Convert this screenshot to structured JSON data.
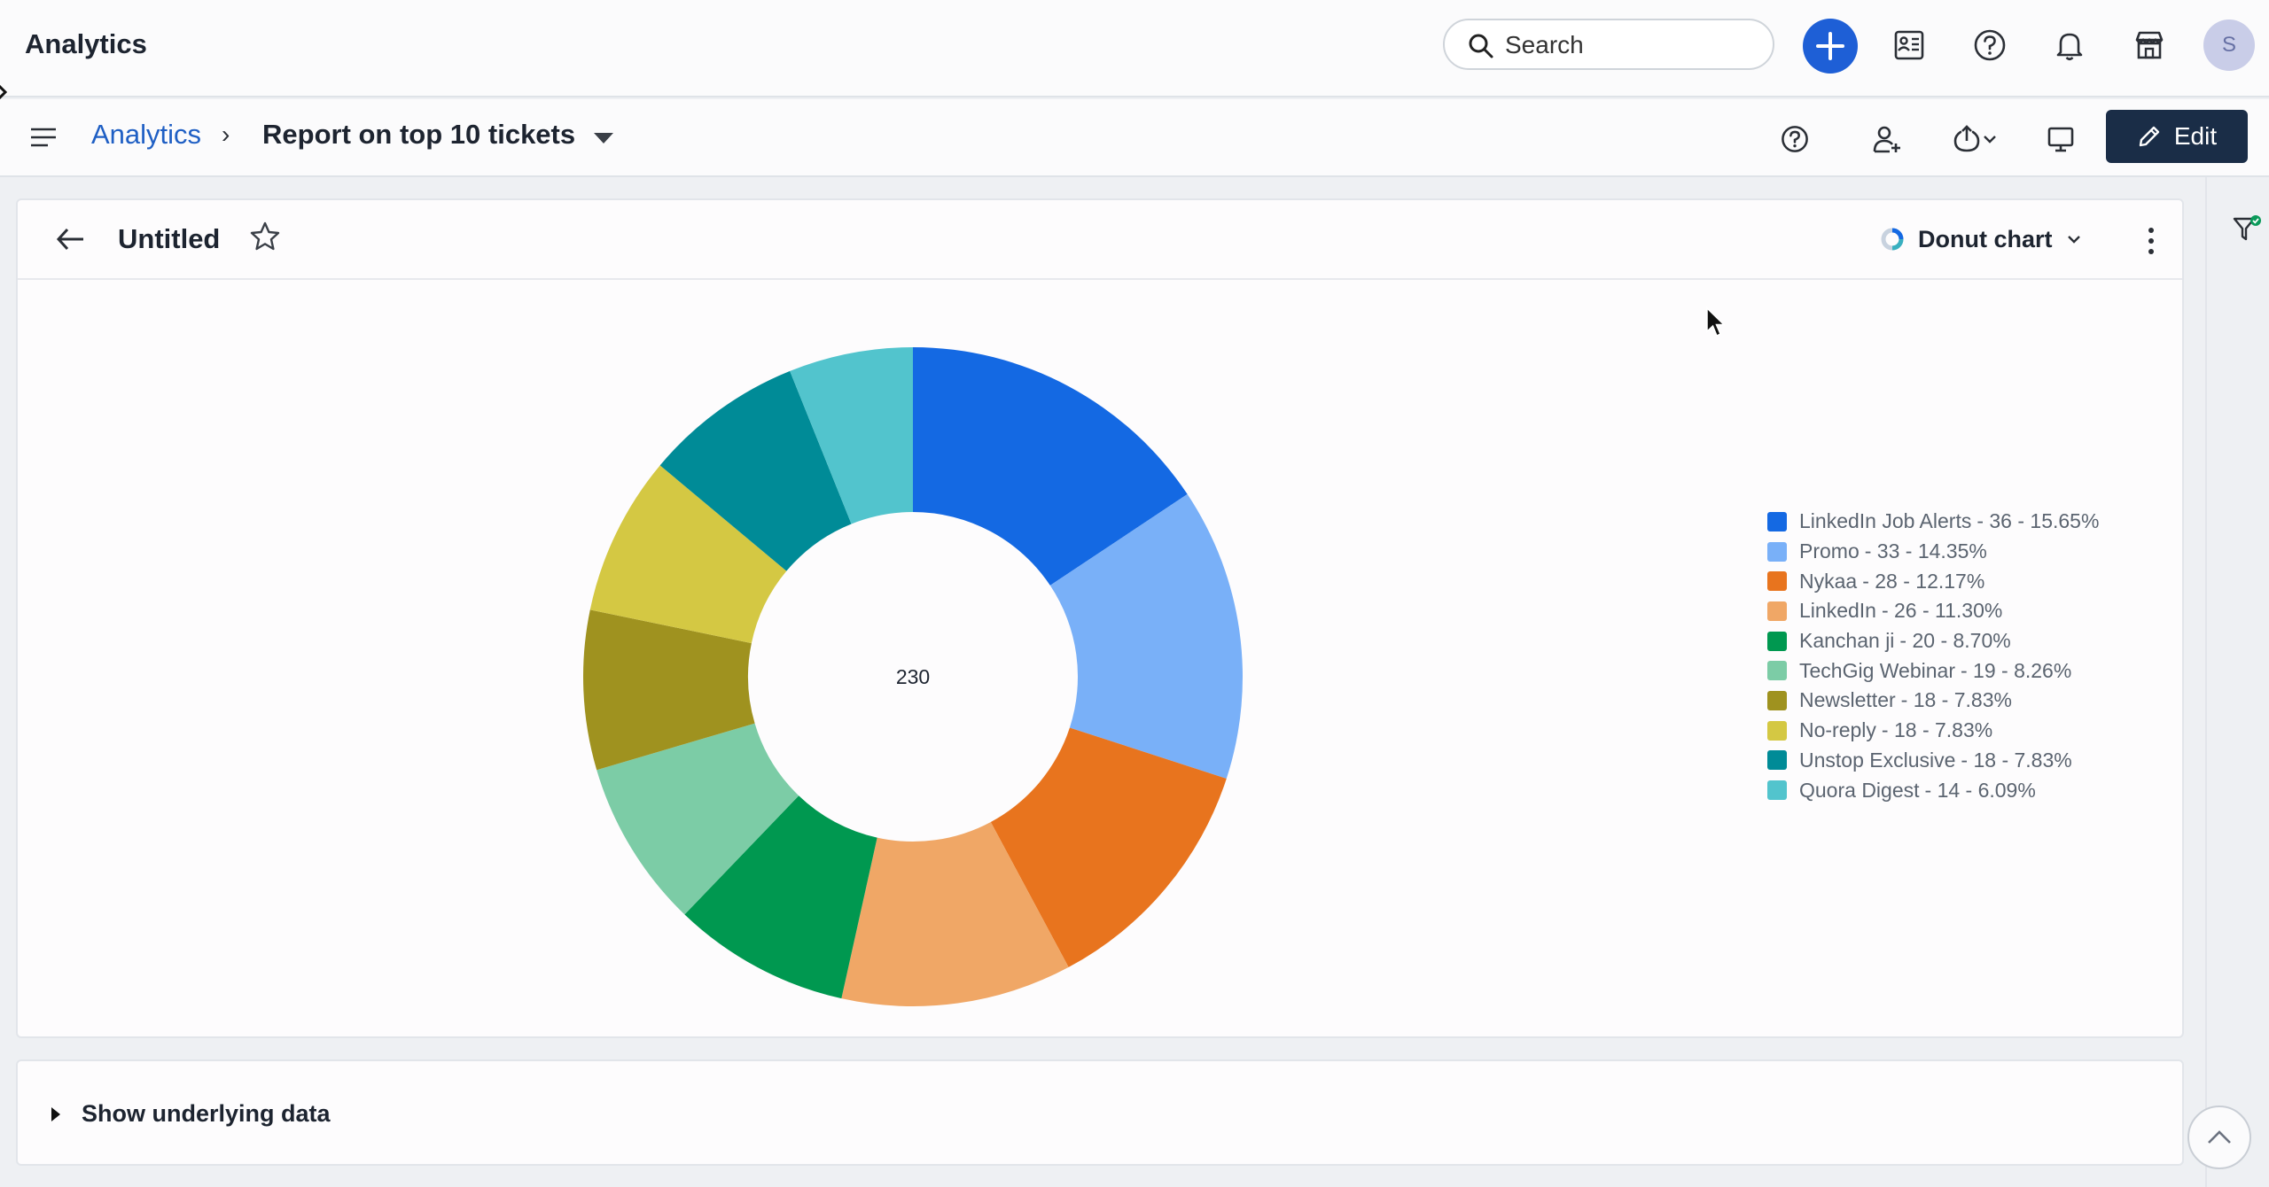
{
  "header": {
    "app_title": "Analytics",
    "search": {
      "placeholder": "Search"
    },
    "avatar_initial": "S"
  },
  "subheader": {
    "breadcrumb_root": "Analytics",
    "breadcrumb_sep": "›",
    "breadcrumb_current": "Report on top 10 tickets",
    "edit_label": "Edit"
  },
  "card": {
    "title": "Untitled",
    "chart_type_label": "Donut chart"
  },
  "under": {
    "label": "Show underlying data"
  },
  "colors": {
    "accent": "#1e5fd6",
    "edit_button": "#1a2d47"
  },
  "chart_data": {
    "type": "pie",
    "variant": "donut",
    "total": 230,
    "total_label": "230",
    "legend_placement": "right",
    "slices": [
      {
        "name": "LinkedIn Job Alerts",
        "value": 36,
        "percent": "15.65%",
        "color": "#1469e3"
      },
      {
        "name": "Promo",
        "value": 33,
        "percent": "14.35%",
        "color": "#79b0f8"
      },
      {
        "name": "Nykaa",
        "value": 28,
        "percent": "12.17%",
        "color": "#e8741e"
      },
      {
        "name": "LinkedIn",
        "value": 26,
        "percent": "11.30%",
        "color": "#f0a766"
      },
      {
        "name": "Kanchan ji",
        "value": 20,
        "percent": "8.70%",
        "color": "#009850"
      },
      {
        "name": "TechGig Webinar",
        "value": 19,
        "percent": "8.26%",
        "color": "#7ccca6"
      },
      {
        "name": "Newsletter",
        "value": 18,
        "percent": "7.83%",
        "color": "#9f921f"
      },
      {
        "name": "No-reply",
        "value": 18,
        "percent": "7.83%",
        "color": "#d4c843"
      },
      {
        "name": "Unstop Exclusive",
        "value": 18,
        "percent": "7.83%",
        "color": "#008b97"
      },
      {
        "name": "Quora Digest",
        "value": 14,
        "percent": "6.09%",
        "color": "#52c4cd"
      }
    ]
  }
}
